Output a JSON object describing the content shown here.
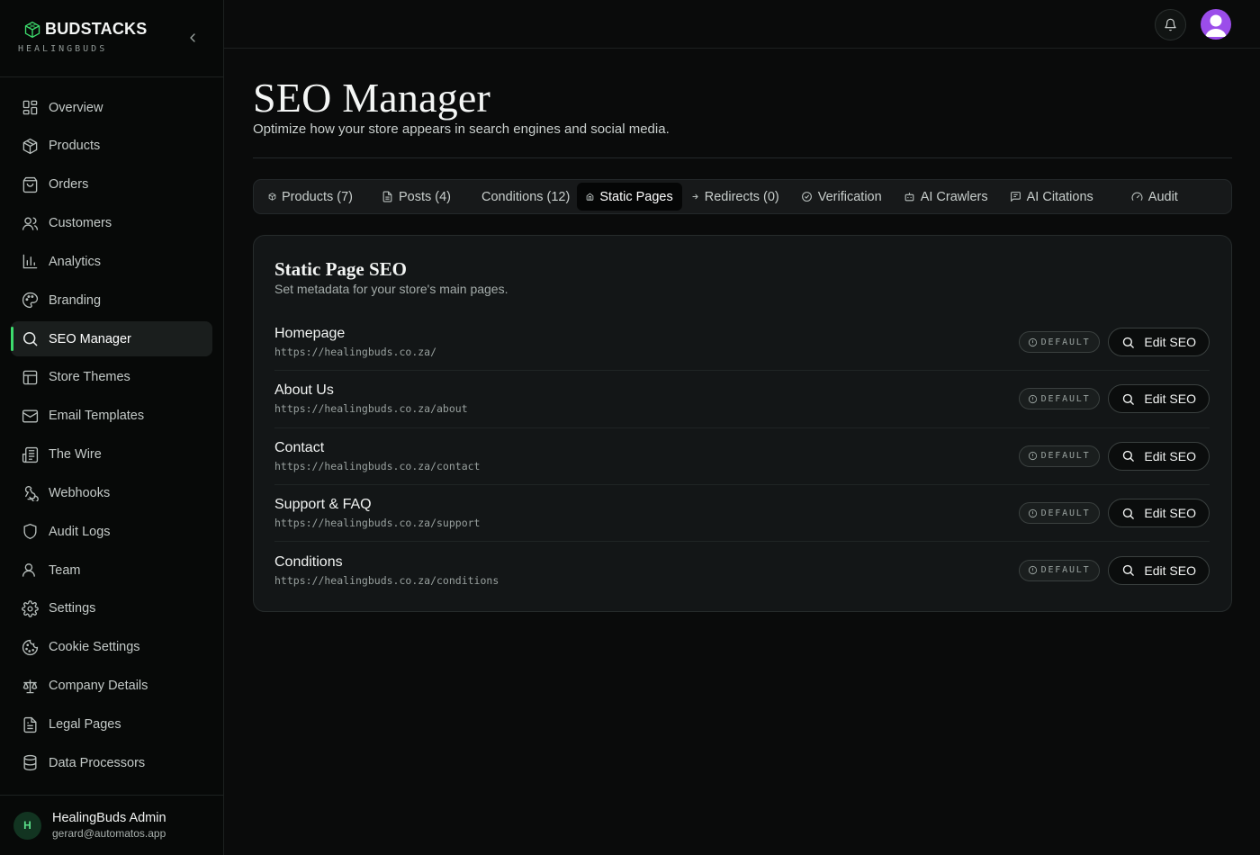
{
  "brand": {
    "name": "BUDSTACKS",
    "subtitle": "HEALINGBUDS",
    "accent": "#3ddc6d"
  },
  "sidebar": {
    "items": [
      {
        "label": "Overview",
        "icon": "layout-dashboard-icon"
      },
      {
        "label": "Products",
        "icon": "package-icon"
      },
      {
        "label": "Orders",
        "icon": "shopping-bag-icon"
      },
      {
        "label": "Customers",
        "icon": "users-icon"
      },
      {
        "label": "Analytics",
        "icon": "bar-chart-icon"
      },
      {
        "label": "Branding",
        "icon": "palette-icon"
      },
      {
        "label": "SEO Manager",
        "icon": "search-icon",
        "active": true
      },
      {
        "label": "Store Themes",
        "icon": "layout-template-icon"
      },
      {
        "label": "Email Templates",
        "icon": "mail-icon"
      },
      {
        "label": "The Wire",
        "icon": "newspaper-icon"
      },
      {
        "label": "Webhooks",
        "icon": "webhook-icon"
      },
      {
        "label": "Audit Logs",
        "icon": "shield-icon"
      },
      {
        "label": "Team",
        "icon": "user-icon"
      },
      {
        "label": "Settings",
        "icon": "gear-icon"
      },
      {
        "label": "Cookie Settings",
        "icon": "cookie-icon"
      },
      {
        "label": "Company Details",
        "icon": "scale-icon"
      },
      {
        "label": "Legal Pages",
        "icon": "file-text-icon"
      },
      {
        "label": "Data Processors",
        "icon": "database-icon"
      }
    ]
  },
  "user": {
    "initial": "H",
    "name": "HealingBuds Admin",
    "email": "gerard@automatos.app"
  },
  "header": {
    "title": "SEO Manager",
    "subtitle": "Optimize how your store appears in search engines and social media."
  },
  "tabs": [
    {
      "label": "Products (7)",
      "icon": "package-icon"
    },
    {
      "label": "Posts (4)",
      "icon": "file-text-icon"
    },
    {
      "label": "Conditions (12)",
      "icon": ""
    },
    {
      "label": "Static Pages",
      "icon": "home-icon",
      "active": true
    },
    {
      "label": "Redirects (0)",
      "icon": "arrow-right-icon"
    },
    {
      "label": "Verification",
      "icon": "check-circle-icon"
    },
    {
      "label": "AI Crawlers",
      "icon": "bot-icon"
    },
    {
      "label": "AI Citations",
      "icon": "message-square-icon"
    },
    {
      "label": "Audit",
      "icon": "gauge-icon"
    }
  ],
  "card": {
    "title": "Static Page SEO",
    "subtitle": "Set metadata for your store's main pages.",
    "badge_label": "DEFAULT",
    "edit_label": "Edit SEO",
    "pages": [
      {
        "name": "Homepage",
        "url": "https://healingbuds.co.za/"
      },
      {
        "name": "About Us",
        "url": "https://healingbuds.co.za/about"
      },
      {
        "name": "Contact",
        "url": "https://healingbuds.co.za/contact"
      },
      {
        "name": "Support & FAQ",
        "url": "https://healingbuds.co.za/support"
      },
      {
        "name": "Conditions",
        "url": "https://healingbuds.co.za/conditions"
      }
    ]
  }
}
